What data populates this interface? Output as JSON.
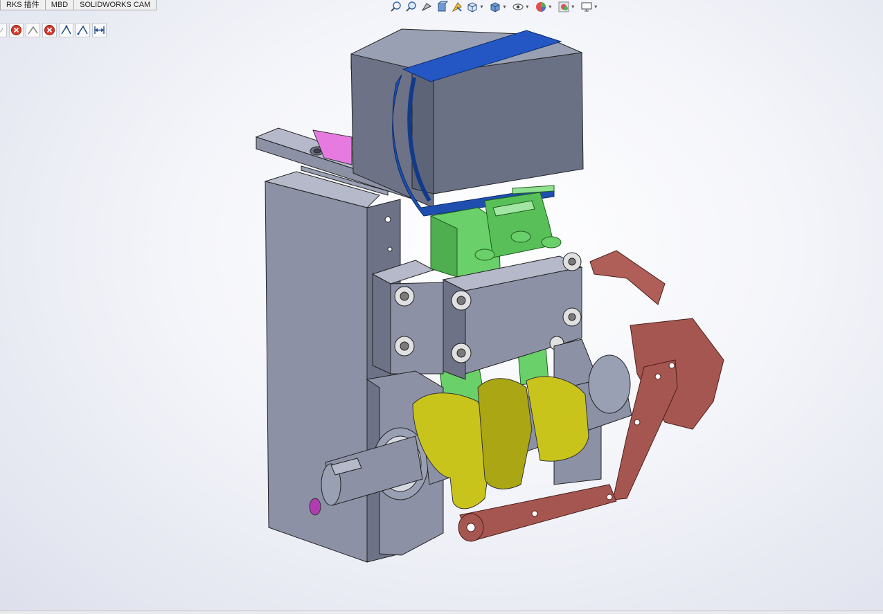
{
  "tabs": [
    "RKS 插件",
    "MBD",
    "SOLIDWORKS CAM"
  ],
  "sketch_toolbar": {
    "icons": [
      "line-icon",
      "close-circle-icon",
      "line-icon",
      "close-circle-icon",
      "angle-icon",
      "angle-icon",
      "horizontal-dimension-icon"
    ]
  },
  "heads_up_toolbar": {
    "icons": [
      "zoom-to-fit-icon",
      "zoom-to-area-icon",
      "previous-view-icon",
      "section-view-icon",
      "dynamic-annotation-icon",
      "view-orientation-icon",
      "display-style-icon",
      "hide-show-icon",
      "edit-appearance-icon",
      "apply-scene-icon",
      "view-settings-icon"
    ]
  },
  "colors": {
    "frame_gray": "#8c91a6",
    "motor_gray": "#6b7184",
    "belt_blue": "#1f4fae",
    "pcb_green": "#6ad06a",
    "cam_yellow": "#c9c41c",
    "lever_red": "#a65650",
    "magenta": "#e77ae0"
  }
}
